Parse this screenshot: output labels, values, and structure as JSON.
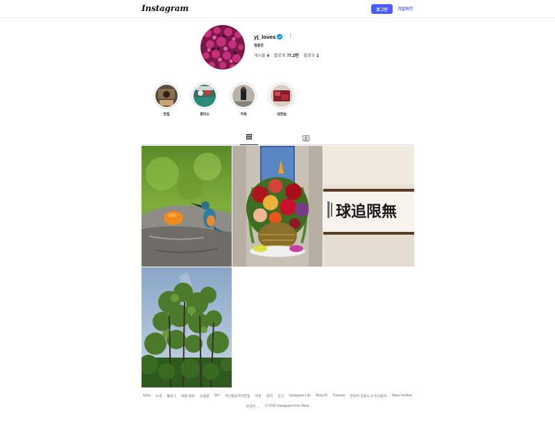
{
  "header": {
    "logo": "Instagram",
    "login_label": "로그인",
    "signup_label": "가입하기"
  },
  "profile": {
    "username": "yj_loves",
    "full_name": "정용진",
    "more_icon": "more-horizontal-icon",
    "verified_color": "#0095f6",
    "stats": [
      {
        "label": "게시물",
        "value": "4"
      },
      {
        "label": "팔로워",
        "value": "77.2만"
      },
      {
        "label": "팔로우",
        "value": "1"
      }
    ]
  },
  "highlights": [
    {
      "label": "맛집"
    },
    {
      "label": "랜더스"
    },
    {
      "label": "가족"
    },
    {
      "label": "냉장실"
    }
  ],
  "tabs": [
    {
      "icon": "grid-icon",
      "selected": true
    },
    {
      "icon": "tagged-icon",
      "selected": false
    }
  ],
  "posts": [
    {
      "description_icon": "kingfisher-photo"
    },
    {
      "description_icon": "flower-bouquet-photo"
    },
    {
      "description_icon": "calligraphy-photo"
    },
    {
      "description_icon": "trees-photo"
    }
  ],
  "calligraphy_text": "球追限無",
  "footer": {
    "links": [
      "Meta",
      "소개",
      "블로그",
      "채용 정보",
      "도움말",
      "API",
      "개인정보처리방침",
      "약관",
      "위치",
      "인기",
      "Instagram Lite",
      "Meta AI",
      "Threads",
      "연락처 업로드 & 비사용자",
      "Meta Verified"
    ],
    "language": "한국어",
    "copyright": "© 2026 Instagram from Meta"
  },
  "colors": {
    "accent": "#4a5df9",
    "link": "#3a55f0"
  }
}
